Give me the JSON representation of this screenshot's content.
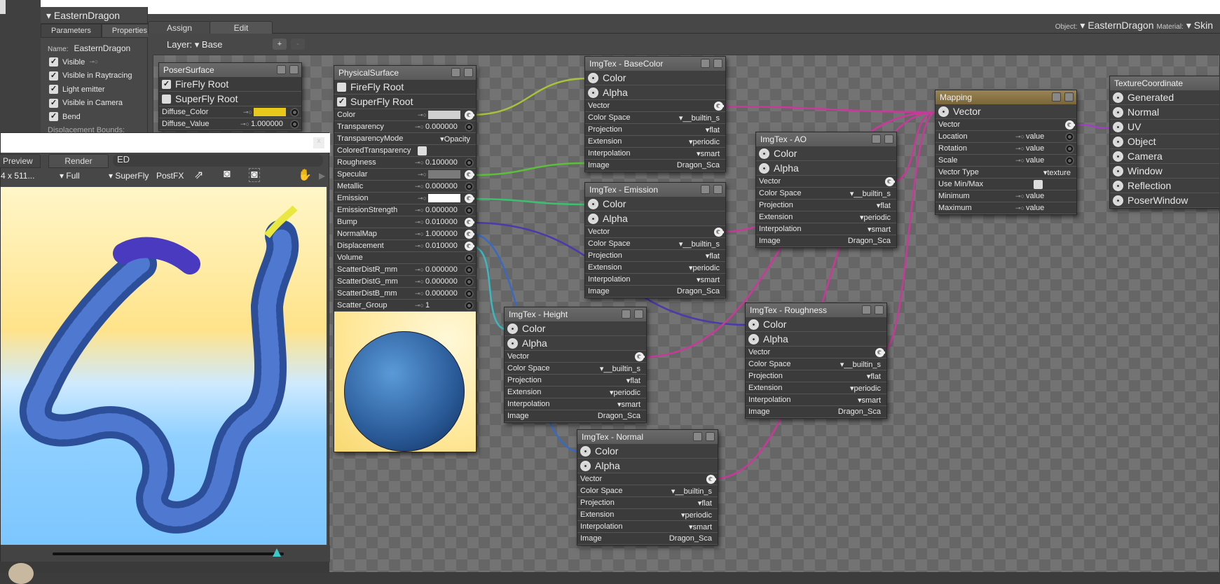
{
  "properties_panel": {
    "title": "EasternDragon",
    "tabs": [
      "Parameters",
      "Properties"
    ],
    "name_label": "Name:",
    "name_value": "EasternDragon",
    "checkboxes": [
      {
        "label": "Visible",
        "checked": true
      },
      {
        "label": "Visible in Raytracing",
        "checked": true
      },
      {
        "label": "Light emitter",
        "checked": true
      },
      {
        "label": "Visible in Camera",
        "checked": true
      },
      {
        "label": "Bend",
        "checked": true
      }
    ],
    "cut_label": "Displacement Bounds:"
  },
  "material_room": {
    "tabs": [
      "Assign",
      "Edit"
    ],
    "active_tab": "Edit",
    "object_label": "Object:",
    "object_value": "EasternDragon",
    "material_label": "Material:",
    "material_value": "Skin",
    "layer_label": "Layer:",
    "layer_value": "Base",
    "add_label": "+",
    "remove_label": "-"
  },
  "render_window": {
    "tabs": [
      "Preview",
      "Render"
    ],
    "active_tab": "Render",
    "extra_tab": "ED",
    "resolution": "4 x 511...",
    "area": "Full",
    "engine": "SuperFly",
    "postfx": "PostFX",
    "slider_value": 0.97,
    "close_label": "x"
  },
  "wire_colors": {
    "color": "#a8c23a",
    "specular": "#5cbf3c",
    "emission": "#3cc070",
    "bump": "#4a3aaa",
    "normal": "#3a6ac0",
    "displacement": "#3ab8c0",
    "vector": "#c83a9a",
    "uv": "#a040c0"
  },
  "nodes": [
    {
      "id": "poser",
      "title": "PoserSurface",
      "rows": [
        {
          "kind": "check",
          "label": "FireFly Root",
          "checked": true
        },
        {
          "kind": "check",
          "label": "SuperFly Root",
          "checked": false
        },
        {
          "kind": "param",
          "label": "Diffuse_Color",
          "key": true,
          "swatch": "#e8c81a",
          "socket": "plain"
        },
        {
          "kind": "param",
          "label": "Diffuse_Value",
          "key": true,
          "value": "1.000000",
          "socket": "plain"
        }
      ]
    },
    {
      "id": "physical",
      "title": "PhysicalSurface",
      "preview": true,
      "rows": [
        {
          "kind": "check",
          "label": "FireFly Root",
          "checked": false
        },
        {
          "kind": "check",
          "label": "SuperFly Root",
          "checked": true
        },
        {
          "kind": "param",
          "label": "Color",
          "key": true,
          "swatch": "#d0d0d0",
          "socket": "linked"
        },
        {
          "kind": "param",
          "label": "Transparency",
          "key": true,
          "value": "0.000000",
          "socket": "plain"
        },
        {
          "kind": "param",
          "label": "TransparencyMode",
          "dropdown": "Opacity"
        },
        {
          "kind": "param",
          "label": "ColoredTransparency",
          "checkbox": true
        },
        {
          "kind": "param",
          "label": "Roughness",
          "key": true,
          "value": "0.100000",
          "socket": "plain"
        },
        {
          "kind": "param",
          "label": "Specular",
          "key": true,
          "swatch": "#7a7a7a",
          "socket": "linked"
        },
        {
          "kind": "param",
          "label": "Metallic",
          "key": true,
          "value": "0.000000",
          "socket": "plain"
        },
        {
          "kind": "param",
          "label": "Emission",
          "key": true,
          "swatch": "#ffffff",
          "socket": "linked"
        },
        {
          "kind": "param",
          "label": "EmissionStrength",
          "key": true,
          "value": "0.000000",
          "socket": "plain"
        },
        {
          "kind": "param",
          "label": "Bump",
          "key": true,
          "value": "0.010000",
          "socket": "linked"
        },
        {
          "kind": "param",
          "label": "NormalMap",
          "key": true,
          "value": "1.000000",
          "socket": "linked"
        },
        {
          "kind": "param",
          "label": "Displacement",
          "key": true,
          "value": "0.010000",
          "socket": "linked"
        },
        {
          "kind": "param",
          "label": "Volume",
          "socket": "plain"
        },
        {
          "kind": "param",
          "label": "ScatterDistR_mm",
          "key": true,
          "value": "0.000000",
          "socket": "plain"
        },
        {
          "kind": "param",
          "label": "ScatterDistG_mm",
          "key": true,
          "value": "0.000000",
          "socket": "plain"
        },
        {
          "kind": "param",
          "label": "ScatterDistB_mm",
          "key": true,
          "value": "0.000000",
          "socket": "plain"
        },
        {
          "kind": "param",
          "label": "Scatter_Group",
          "key": true,
          "value": "1",
          "socket": "plain"
        }
      ]
    },
    {
      "id": "basecolor",
      "title": "ImgTex - BaseColor",
      "rows": [
        {
          "kind": "big",
          "label": "Color"
        },
        {
          "kind": "big",
          "label": "Alpha"
        },
        {
          "kind": "param",
          "label": "Vector",
          "socket": "linked"
        },
        {
          "kind": "param",
          "label": "Color Space",
          "dropdown": "__builtin_s"
        },
        {
          "kind": "param",
          "label": "Projection",
          "dropdown": "flat"
        },
        {
          "kind": "param",
          "label": "Extension",
          "dropdown": "periodic"
        },
        {
          "kind": "param",
          "label": "Interpolation",
          "dropdown": "smart"
        },
        {
          "kind": "param",
          "label": "Image",
          "text": "Dragon_Sca"
        }
      ]
    },
    {
      "id": "emission",
      "title": "ImgTex - Emission",
      "rows": [
        {
          "kind": "big",
          "label": "Color"
        },
        {
          "kind": "big",
          "label": "Alpha"
        },
        {
          "kind": "param",
          "label": "Vector",
          "socket": "linked"
        },
        {
          "kind": "param",
          "label": "Color Space",
          "dropdown": "__builtin_s"
        },
        {
          "kind": "param",
          "label": "Projection",
          "dropdown": "flat"
        },
        {
          "kind": "param",
          "label": "Extension",
          "dropdown": "periodic"
        },
        {
          "kind": "param",
          "label": "Interpolation",
          "dropdown": "smart"
        },
        {
          "kind": "param",
          "label": "Image",
          "text": "Dragon_Sca"
        }
      ]
    },
    {
      "id": "ao",
      "title": "ImgTex - AO",
      "rows": [
        {
          "kind": "big",
          "label": "Color"
        },
        {
          "kind": "big",
          "label": "Alpha"
        },
        {
          "kind": "param",
          "label": "Vector",
          "socket": "linked"
        },
        {
          "kind": "param",
          "label": "Color Space",
          "dropdown": "__builtin_s"
        },
        {
          "kind": "param",
          "label": "Projection",
          "dropdown": "flat"
        },
        {
          "kind": "param",
          "label": "Extension",
          "dropdown": "periodic"
        },
        {
          "kind": "param",
          "label": "Interpolation",
          "dropdown": "smart"
        },
        {
          "kind": "param",
          "label": "Image",
          "text": "Dragon_Sca"
        }
      ]
    },
    {
      "id": "height",
      "title": "ImgTex - Height",
      "rows": [
        {
          "kind": "big",
          "label": "Color"
        },
        {
          "kind": "big",
          "label": "Alpha"
        },
        {
          "kind": "param",
          "label": "Vector",
          "socket": "linked"
        },
        {
          "kind": "param",
          "label": "Color Space",
          "dropdown": "__builtin_s"
        },
        {
          "kind": "param",
          "label": "Projection",
          "dropdown": "flat"
        },
        {
          "kind": "param",
          "label": "Extension",
          "dropdown": "periodic"
        },
        {
          "kind": "param",
          "label": "Interpolation",
          "dropdown": "smart"
        },
        {
          "kind": "param",
          "label": "Image",
          "text": "Dragon_Sca"
        }
      ]
    },
    {
      "id": "roughness",
      "title": "ImgTex - Roughness",
      "rows": [
        {
          "kind": "big",
          "label": "Color"
        },
        {
          "kind": "big",
          "label": "Alpha"
        },
        {
          "kind": "param",
          "label": "Vector",
          "socket": "linked"
        },
        {
          "kind": "param",
          "label": "Color Space",
          "dropdown": "__builtin_s"
        },
        {
          "kind": "param",
          "label": "Projection",
          "dropdown": "flat"
        },
        {
          "kind": "param",
          "label": "Extension",
          "dropdown": "periodic"
        },
        {
          "kind": "param",
          "label": "Interpolation",
          "dropdown": "smart"
        },
        {
          "kind": "param",
          "label": "Image",
          "text": "Dragon_Sca"
        }
      ]
    },
    {
      "id": "normal",
      "title": "ImgTex - Normal",
      "rows": [
        {
          "kind": "big",
          "label": "Color"
        },
        {
          "kind": "big",
          "label": "Alpha"
        },
        {
          "kind": "param",
          "label": "Vector",
          "socket": "linked"
        },
        {
          "kind": "param",
          "label": "Color Space",
          "dropdown": "__builtin_s"
        },
        {
          "kind": "param",
          "label": "Projection",
          "dropdown": "flat"
        },
        {
          "kind": "param",
          "label": "Extension",
          "dropdown": "periodic"
        },
        {
          "kind": "param",
          "label": "Interpolation",
          "dropdown": "smart"
        },
        {
          "kind": "param",
          "label": "Image",
          "text": "Dragon_Sca"
        }
      ]
    },
    {
      "id": "mapping",
      "title": "Mapping",
      "gold": true,
      "rows": [
        {
          "kind": "big",
          "label": "Vector"
        },
        {
          "kind": "param",
          "label": "Vector",
          "socket": "linked"
        },
        {
          "kind": "param",
          "label": "Location",
          "key": true,
          "value": "value",
          "socket": "plain"
        },
        {
          "kind": "param",
          "label": "Rotation",
          "key": true,
          "value": "value",
          "socket": "plain"
        },
        {
          "kind": "param",
          "label": "Scale",
          "key": true,
          "value": "value",
          "socket": "plain"
        },
        {
          "kind": "param",
          "label": "Vector Type",
          "dropdown": "texture"
        },
        {
          "kind": "param",
          "label": "Use Min/Max",
          "checkbox": true
        },
        {
          "kind": "param",
          "label": "Minimum",
          "key": true,
          "value": "value"
        },
        {
          "kind": "param",
          "label": "Maximum",
          "key": true,
          "value": "value"
        }
      ]
    },
    {
      "id": "texcoord",
      "title": "TextureCoordinate",
      "noicons": true,
      "rows": [
        {
          "kind": "big",
          "label": "Generated"
        },
        {
          "kind": "big",
          "label": "Normal"
        },
        {
          "kind": "big",
          "label": "UV"
        },
        {
          "kind": "big",
          "label": "Object"
        },
        {
          "kind": "big",
          "label": "Camera"
        },
        {
          "kind": "big",
          "label": "Window"
        },
        {
          "kind": "big",
          "label": "Reflection"
        },
        {
          "kind": "big",
          "label": "PoserWindow"
        }
      ]
    }
  ]
}
